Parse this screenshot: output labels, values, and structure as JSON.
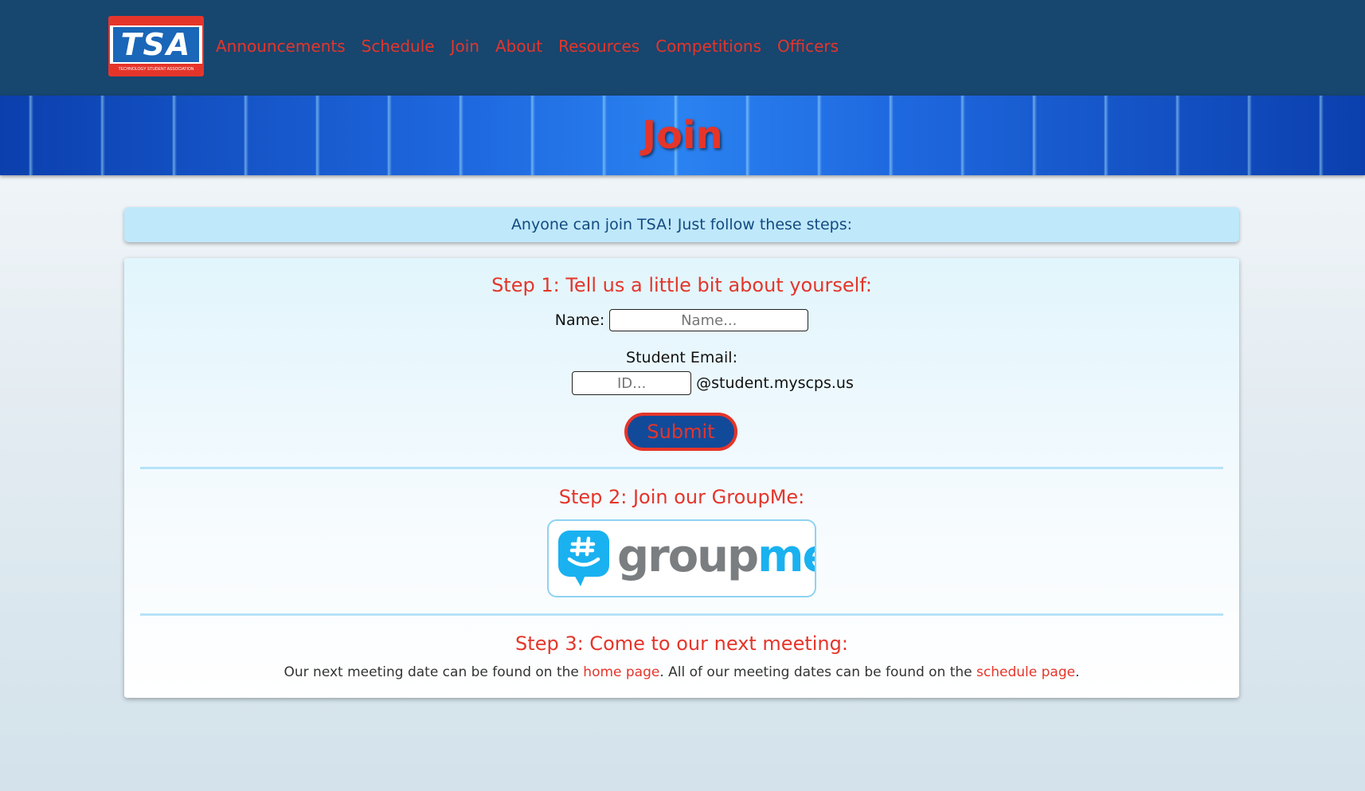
{
  "nav": {
    "logo": {
      "mark": "TSA",
      "caption": "TECHNOLOGY STUDENT ASSOCIATION"
    },
    "links": [
      "Announcements",
      "Schedule",
      "Join",
      "About",
      "Resources",
      "Competitions",
      "Officers"
    ]
  },
  "hero": {
    "title": "Join"
  },
  "intro": "Anyone can join TSA! Just follow these steps:",
  "step1": {
    "title": "Step 1: Tell us a little bit about yourself:",
    "name_label": "Name:",
    "name_placeholder": "Name...",
    "email_label": "Student Email:",
    "id_placeholder": "ID...",
    "email_domain": "@student.myscps.us",
    "submit_label": "Submit"
  },
  "step2": {
    "title": "Step 2: Join our GroupMe:",
    "logo": {
      "part1": "group",
      "part2": "me",
      "icon": "groupme-hash-bubble-icon"
    }
  },
  "step3": {
    "title": "Step 3: Come to our next meeting:",
    "text1": "Our next meeting date can be found on the ",
    "link1": "home page",
    "text2": ". All of our meeting dates can be found on the ",
    "link2": "schedule page",
    "text3": "."
  },
  "colors": {
    "navy": "#17466f",
    "accent_red": "#e5352a",
    "groupme_blue": "#1ab1f0"
  }
}
